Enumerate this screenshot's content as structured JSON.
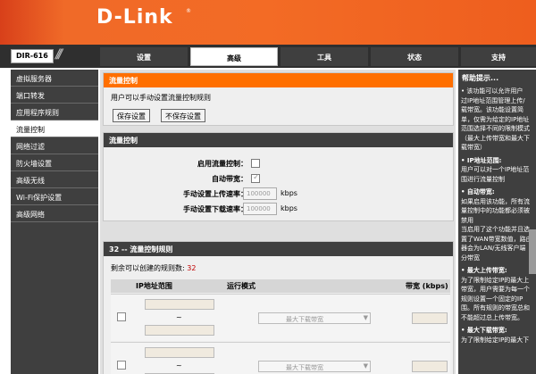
{
  "brand": {
    "logo": "D-Link",
    "reg": "®"
  },
  "model": "DIR-616",
  "tabs": [
    {
      "label": "设置"
    },
    {
      "label": "高级"
    },
    {
      "label": "工具"
    },
    {
      "label": "状态"
    },
    {
      "label": "支持"
    }
  ],
  "sidebar": {
    "items": [
      {
        "label": "虚拟服务器"
      },
      {
        "label": "端口转发"
      },
      {
        "label": "应用程序规则"
      },
      {
        "label": "流量控制"
      },
      {
        "label": "网络过滤"
      },
      {
        "label": "防火墙设置"
      },
      {
        "label": "高级无线"
      },
      {
        "label": "Wi-Fi保护设置"
      },
      {
        "label": "高级网络"
      }
    ]
  },
  "intro": {
    "title": "流量控制",
    "description": "用户可以手动设置流量控制规则",
    "save_label": "保存设置",
    "nosave_label": "不保存设置"
  },
  "qos": {
    "title": "流量控制",
    "enable_label": "启用流量控制：",
    "auto_label": "自动带宽：",
    "upload_label": "手动设置上传速率：",
    "upload_value": "100000",
    "download_label": "手动设置下载速率：",
    "download_value": "100000",
    "unit": "kbps"
  },
  "rules": {
    "title": "32 -- 流量控制规则",
    "remaining_label": "剩余可以创建的规则数:",
    "remaining_count": "32",
    "col_ip": "IP地址范围",
    "col_mode": "运行模式",
    "col_bw": "带宽 (kbps)",
    "tilde": "~",
    "mode_option": "最大下载带宽"
  },
  "help": {
    "title": "帮助提示...",
    "para1": [
      "该功能可以允许用户",
      "过IP地址范围管理上传/",
      "载带宽。该功能设置简",
      "单，仅需为给定的IP地址",
      "范围选择不同的限制模式",
      "（最大上传带宽和最大下",
      "载带宽）"
    ],
    "ip_title": "IP地址范围:",
    "ip_text": [
      "用户可以对一个IP地址范",
      "围进行流量控制"
    ],
    "auto_title": "自动带宽:",
    "auto_text": [
      "如果启用该功能，所有流",
      "量控制中的功能都必须被",
      "禁用",
      "当启用了这个功能并且选",
      "置了WAN带宽数值，路由",
      "器会为LAN/无线客户端",
      "分带宽"
    ],
    "up_title": "最大上传带宽:",
    "up_text": [
      "为了限制给定IP的最大上",
      "带宽，用户需要为每一个",
      "规则设置一个固定的IP",
      "围。所有规则的带宽总和",
      "不能超过总上传带宽。"
    ],
    "down_title": "最大下载带宽:",
    "down_text": [
      "为了限制给定IP的最大下"
    ]
  },
  "colors": {
    "orange": "#ff6f00",
    "dark": "#3f3f3f",
    "accent_red": "#c00000"
  }
}
